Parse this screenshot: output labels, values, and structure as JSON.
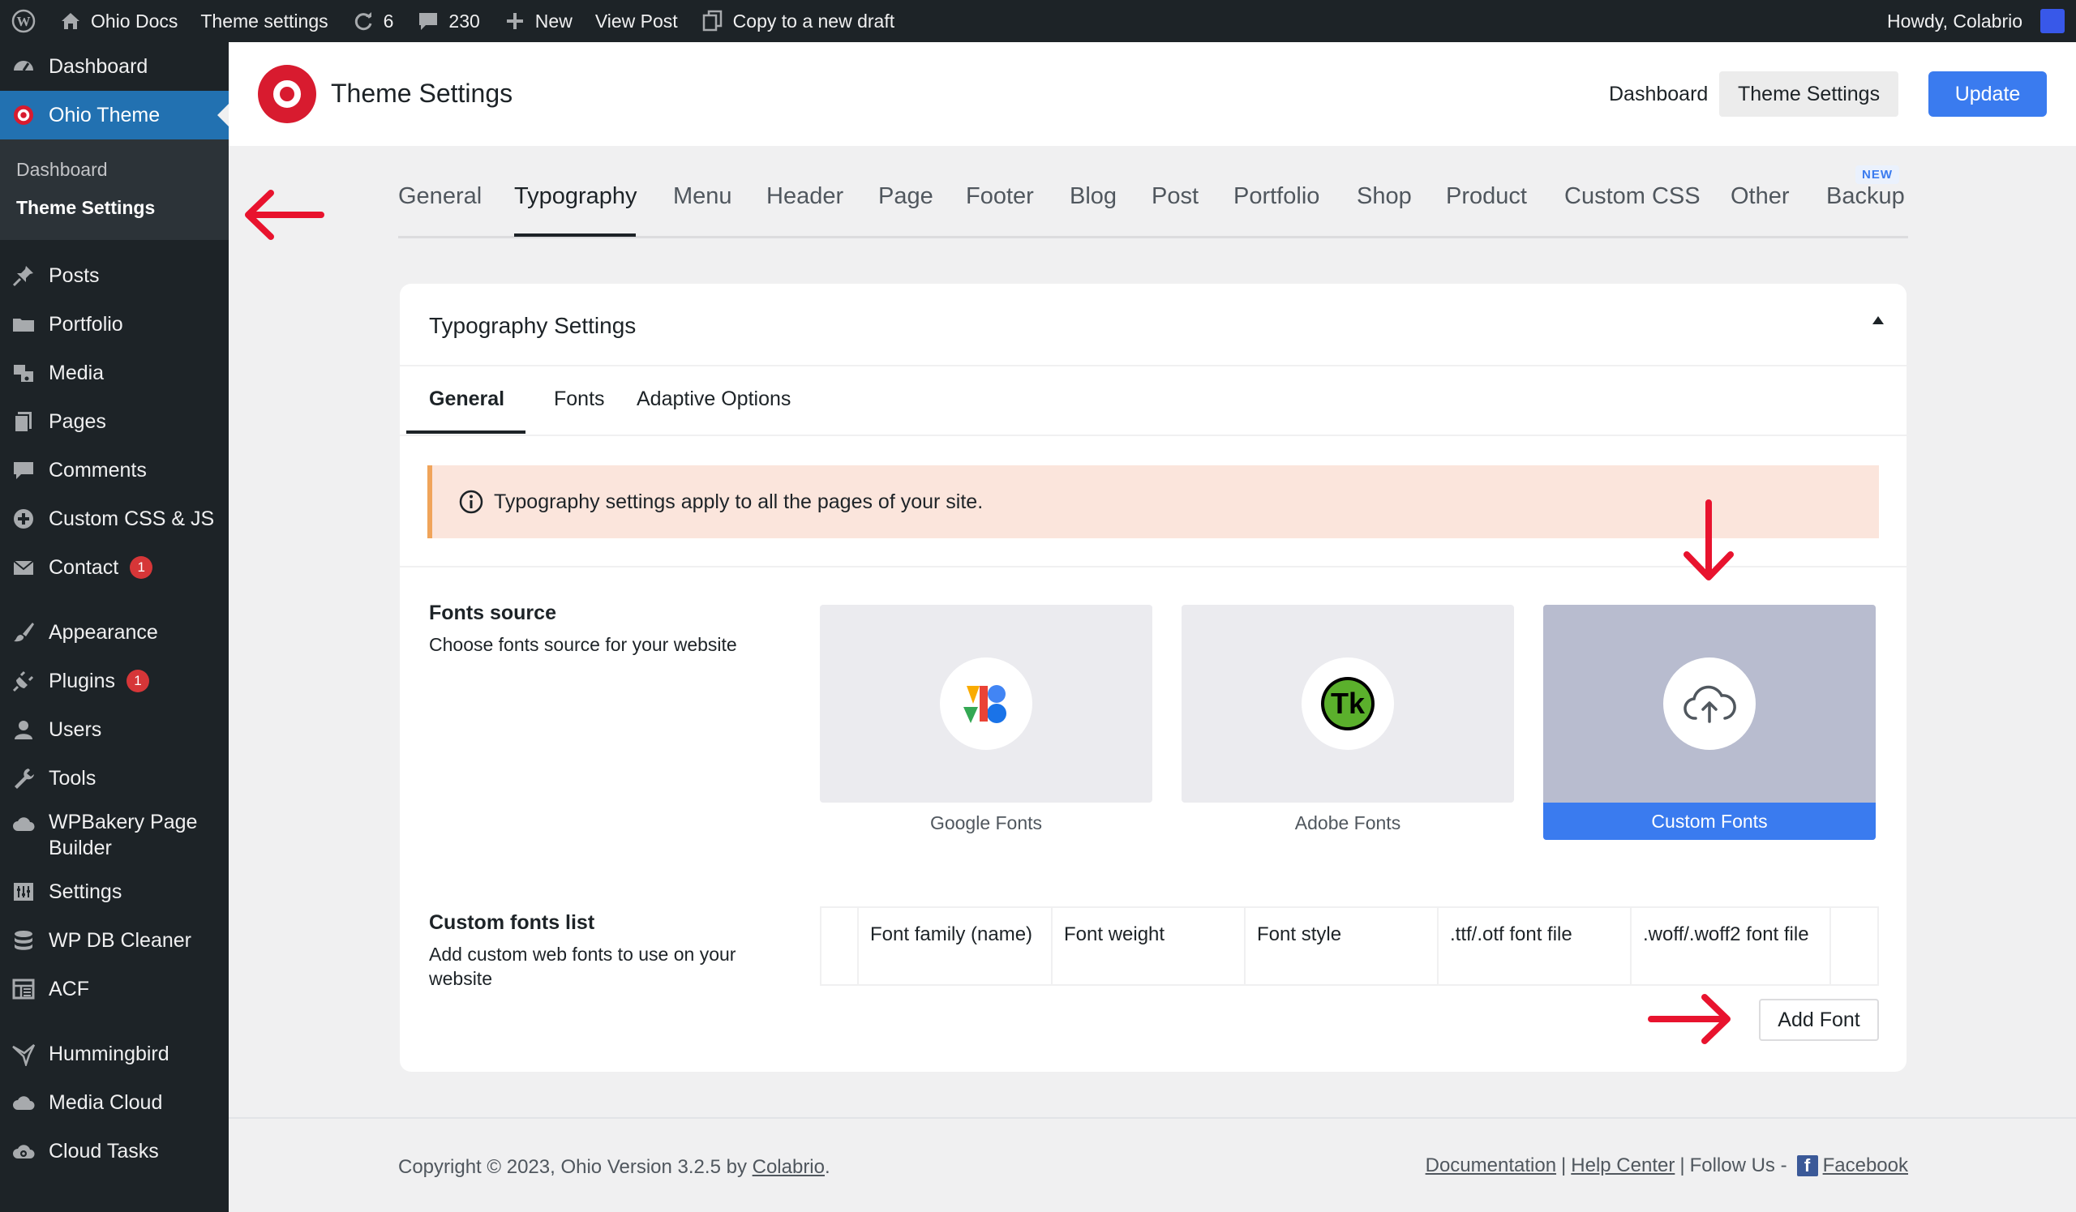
{
  "adminbar": {
    "site_name": "Ohio Docs",
    "theme_settings": "Theme settings",
    "updates_count": "6",
    "comments_count": "230",
    "new_label": "New",
    "view_post": "View Post",
    "copy_draft": "Copy to a new draft",
    "howdy": "Howdy, Colabrio"
  },
  "sidebar": {
    "items": [
      {
        "label": "Dashboard",
        "icon": "dashboard-icon"
      },
      {
        "label": "Ohio Theme",
        "icon": "ohio-theme-icon"
      },
      {
        "label": "Posts",
        "icon": "pin-icon"
      },
      {
        "label": "Portfolio",
        "icon": "folder-icon"
      },
      {
        "label": "Media",
        "icon": "media-icon"
      },
      {
        "label": "Pages",
        "icon": "pages-icon"
      },
      {
        "label": "Comments",
        "icon": "comment-icon"
      },
      {
        "label": "Custom CSS & JS",
        "icon": "plus-circle-icon"
      },
      {
        "label": "Contact",
        "icon": "mail-icon",
        "badge": "1"
      },
      {
        "label": "Appearance",
        "icon": "brush-icon"
      },
      {
        "label": "Plugins",
        "icon": "plug-icon",
        "badge": "1"
      },
      {
        "label": "Users",
        "icon": "user-icon"
      },
      {
        "label": "Tools",
        "icon": "wrench-icon"
      },
      {
        "label": "WPBakery Page Builder",
        "icon": "cloud-icon"
      },
      {
        "label": "Settings",
        "icon": "sliders-icon"
      },
      {
        "label": "WP DB Cleaner",
        "icon": "database-icon"
      },
      {
        "label": "ACF",
        "icon": "table-icon"
      },
      {
        "label": "Hummingbird",
        "icon": "bird-icon"
      },
      {
        "label": "Media Cloud",
        "icon": "cloud-icon"
      },
      {
        "label": "Cloud Tasks",
        "icon": "gear-cloud-icon"
      }
    ],
    "submenu": [
      "Dashboard",
      "Theme Settings"
    ]
  },
  "header": {
    "title": "Theme Settings",
    "nav_dashboard": "Dashboard",
    "nav_theme": "Theme Settings",
    "update": "Update"
  },
  "main_tabs": [
    "General",
    "Typography",
    "Menu",
    "Header",
    "Page",
    "Footer",
    "Blog",
    "Post",
    "Portfolio",
    "Shop",
    "Product",
    "Custom CSS",
    "Other",
    "Backup"
  ],
  "new_badge": "NEW",
  "card": {
    "title": "Typography Settings",
    "subtabs": [
      "General",
      "Fonts",
      "Adaptive Options"
    ],
    "notice": "Typography settings apply to all the pages of your site.",
    "fonts_source_label": "Fonts source",
    "fonts_source_desc": "Choose fonts source for your website",
    "sources": [
      "Google Fonts",
      "Adobe Fonts",
      "Custom Fonts"
    ],
    "selected_source": "Custom Fonts",
    "custom_list_label": "Custom fonts list",
    "custom_list_desc": "Add custom web fonts to use on your website",
    "table_headers": [
      "Font family (name)",
      "Font weight",
      "Font style",
      ".ttf/.otf font file",
      ".woff/.woff2 font file"
    ],
    "add_font": "Add Font"
  },
  "footer": {
    "copyright": "Copyright © 2023, Ohio Version 3.2.5 by ",
    "brand": "Colabrio",
    "period": ".",
    "documentation": "Documentation",
    "help_center": "Help Center",
    "follow": "Follow Us -",
    "facebook": "Facebook",
    "sep": "|"
  },
  "colors": {
    "accent": "#3a7bef",
    "brand_red": "#d81b2f",
    "sidebar_bg": "#1d2327",
    "active_menu": "#2271b1",
    "annotation_red": "#e8132e"
  }
}
